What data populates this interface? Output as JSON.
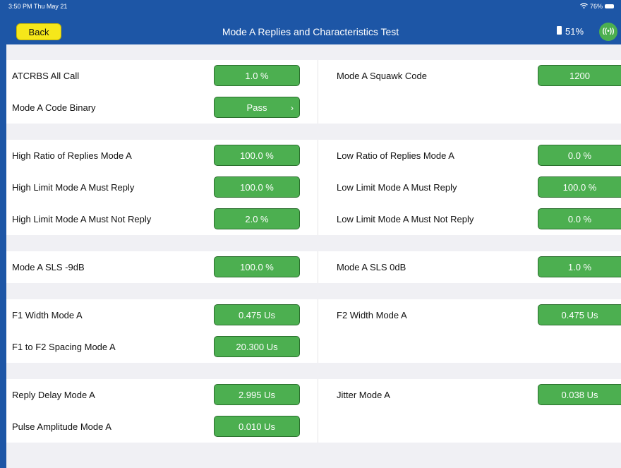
{
  "status_bar": {
    "time": "3:50 PM  Thu May 21",
    "wifi_battery": "76%"
  },
  "header": {
    "back_label": "Back",
    "title": "Mode A Replies and Characteristics Test",
    "battery": "51%",
    "connection_icon": "((•))"
  },
  "groups": [
    {
      "rows": [
        {
          "left": {
            "label": "ATCRBS All Call",
            "value": "1.0 %"
          },
          "right": {
            "label": "Mode A Squawk Code",
            "value": "1200"
          }
        },
        {
          "left": {
            "label": "Mode A Code Binary",
            "value": "Pass",
            "chevron": "›"
          },
          "right": null
        }
      ]
    },
    {
      "rows": [
        {
          "left": {
            "label": "High Ratio of Replies Mode A",
            "value": "100.0 %"
          },
          "right": {
            "label": "Low Ratio of Replies Mode A",
            "value": "0.0 %"
          }
        },
        {
          "left": {
            "label": "High Limit Mode A Must Reply",
            "value": "100.0 %"
          },
          "right": {
            "label": "Low Limit  Mode A Must Reply",
            "value": "100.0 %"
          }
        },
        {
          "left": {
            "label": "High Limit Mode A Must Not Reply",
            "value": "2.0 %"
          },
          "right": {
            "label": "Low Limit Mode A Must Not Reply",
            "value": "0.0 %"
          }
        }
      ]
    },
    {
      "rows": [
        {
          "left": {
            "label": "Mode A SLS -9dB",
            "value": "100.0 %"
          },
          "right": {
            "label": "Mode A SLS 0dB",
            "value": "1.0 %"
          }
        }
      ]
    },
    {
      "rows": [
        {
          "left": {
            "label": "F1 Width Mode A",
            "value": "0.475 Us"
          },
          "right": {
            "label": "F2 Width Mode A",
            "value": "0.475 Us"
          }
        },
        {
          "left": {
            "label": "F1 to F2 Spacing Mode A",
            "value": "20.300 Us"
          },
          "right": null
        }
      ]
    },
    {
      "rows": [
        {
          "left": {
            "label": "Reply Delay Mode A",
            "value": "2.995 Us"
          },
          "right": {
            "label": "Jitter Mode A",
            "value": "0.038 Us"
          }
        },
        {
          "left": {
            "label": "Pulse Amplitude Mode A",
            "value": "0.010 Us"
          },
          "right": null
        }
      ]
    }
  ],
  "colors": {
    "header": "#1d56a6",
    "back_button": "#f6e71a",
    "value_button": "#4caf50",
    "background": "#f0f0f4"
  }
}
